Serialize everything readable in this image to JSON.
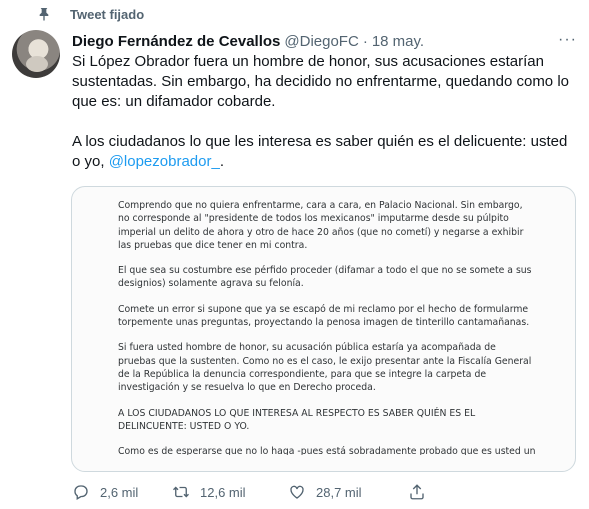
{
  "pinned_label": "Tweet fijado",
  "author": {
    "name": "Diego Fernández de Cevallos",
    "handle": "@DiegoFC",
    "separator": "·",
    "time": "18 may."
  },
  "more_label": "···",
  "tweet": {
    "paragraph1": "Si López Obrador fuera un hombre de honor, sus acusaciones estarían sustentadas. Sin embargo, ha decidido no enfrentarme, quedando como lo que es: un difamador cobarde.",
    "paragraph2_prefix": "A los ciudadanos lo que les interesa es saber quién es el delicuente: usted o yo, ",
    "mention": "@lopezobrador_",
    "paragraph2_suffix": "."
  },
  "document": {
    "p1": "Comprendo que no quiera enfrentarme, cara a cara, en Palacio Nacional. Sin embargo, no corresponde al \"presidente de todos los mexicanos\" imputarme desde su púlpito imperial un delito de ahora y otro de hace 20 años (que no cometí) y negarse a exhibir las pruebas que dice tener en mi contra.",
    "p2": "El que sea su costumbre ese pérfido proceder (difamar a todo el que no se somete a sus designios) solamente agrava su felonía.",
    "p3": "Comete un error si supone que ya se escapó de mi reclamo por el hecho de formularme torpemente unas preguntas, proyectando la penosa imagen de tinterillo cantamañanas.",
    "p4": "Si fuera usted hombre de honor, su acusación pública estaría ya acompañada de pruebas que la sustenten. Como no es el caso, le exijo presentar ante la Fiscalía General de la República la denuncia correspondiente, para que se integre la carpeta de investigación y se resuelva lo que en Derecho proceda.",
    "p5": "A LOS CIUDADANOS LO QUE INTERESA AL RESPECTO ES SABER QUIÉN ES EL DELINCUENTE: USTED O YO.",
    "p6": "Como es de esperarse que no lo haga -pues está sobradamente probado que es usted un"
  },
  "actions": {
    "replies": "2,6 mil",
    "retweets": "12,6 mil",
    "likes": "28,7 mil"
  },
  "icons": {
    "pin": "pin-icon",
    "reply": "reply-icon",
    "retweet": "retweet-icon",
    "like": "heart-icon",
    "share": "share-icon"
  }
}
